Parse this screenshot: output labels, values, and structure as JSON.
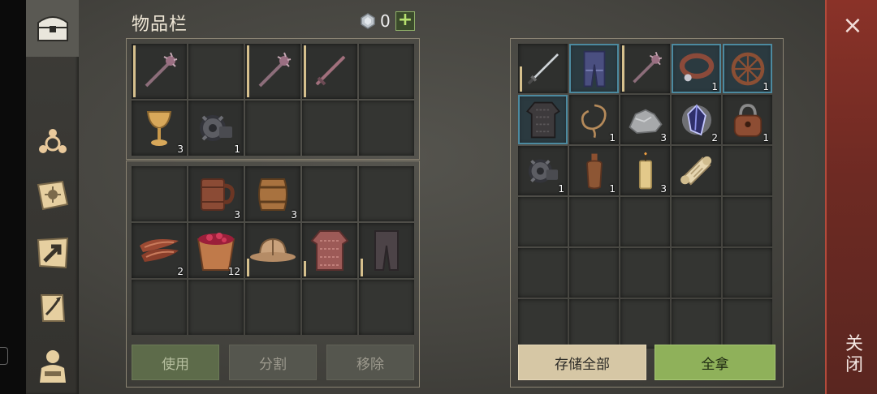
{
  "title": "物品栏",
  "gem_count": "0",
  "plus_label": "+",
  "buttons": {
    "use": "使用",
    "split": "分割",
    "remove": "移除",
    "store_all": "存储全部",
    "take_all": "全拿"
  },
  "close": {
    "icon": "×",
    "label": "关闭"
  },
  "sidebar": [
    {
      "name": "chest-icon"
    },
    {
      "name": "skills-icon"
    },
    {
      "name": "recipes-book-icon"
    },
    {
      "name": "map-arrow-icon"
    },
    {
      "name": "quests-scroll-icon"
    },
    {
      "name": "character-icon"
    }
  ],
  "inventory_top": [
    {
      "item": "mace-icon",
      "qty": "",
      "bar": 1.0
    },
    {
      "item": "empty",
      "qty": ""
    },
    {
      "item": "mace-icon",
      "qty": "",
      "bar": 1.0
    },
    {
      "item": "sword-icon",
      "qty": "",
      "bar": 1.0
    },
    {
      "item": "empty",
      "qty": ""
    },
    {
      "item": "goblet-icon",
      "qty": "3"
    },
    {
      "item": "gear-scrap-icon",
      "qty": "1"
    },
    {
      "item": "empty",
      "qty": ""
    },
    {
      "item": "empty",
      "qty": ""
    },
    {
      "item": "empty",
      "qty": ""
    }
  ],
  "inventory_bottom": [
    {
      "item": "empty",
      "qty": ""
    },
    {
      "item": "mug-icon",
      "qty": "3"
    },
    {
      "item": "barrel-icon",
      "qty": "3"
    },
    {
      "item": "empty",
      "qty": ""
    },
    {
      "item": "empty",
      "qty": ""
    },
    {
      "item": "meat-icon",
      "qty": "2"
    },
    {
      "item": "berry-bucket-icon",
      "qty": "12"
    },
    {
      "item": "helmet-icon",
      "qty": "",
      "bar": 0.35
    },
    {
      "item": "chainmail-icon",
      "qty": "",
      "bar": 0.3
    },
    {
      "item": "pants-icon",
      "qty": "",
      "bar": 0.35
    },
    {
      "item": "empty",
      "qty": ""
    },
    {
      "item": "empty",
      "qty": ""
    },
    {
      "item": "empty",
      "qty": ""
    },
    {
      "item": "empty",
      "qty": ""
    },
    {
      "item": "empty",
      "qty": ""
    }
  ],
  "chest": [
    {
      "item": "longsword-icon",
      "qty": "",
      "bar": 0.55
    },
    {
      "item": "blue-pants-icon",
      "qty": "",
      "sel": true
    },
    {
      "item": "mace-icon",
      "qty": "",
      "bar": 1.0
    },
    {
      "item": "collar-icon",
      "qty": "1",
      "sel": true
    },
    {
      "item": "wheel-icon",
      "qty": "1",
      "sel": true
    },
    {
      "item": "dark-armor-icon",
      "qty": "",
      "sel": true
    },
    {
      "item": "rope-icon",
      "qty": "1"
    },
    {
      "item": "stone-icon",
      "qty": "3"
    },
    {
      "item": "crystal-icon",
      "qty": "2"
    },
    {
      "item": "padlock-icon",
      "qty": "1"
    },
    {
      "item": "gear-scrap-icon",
      "qty": "1"
    },
    {
      "item": "bottle-icon",
      "qty": "1"
    },
    {
      "item": "candle-icon",
      "qty": "3"
    },
    {
      "item": "scroll-icon",
      "qty": ""
    },
    {
      "item": "empty",
      "qty": ""
    },
    {
      "item": "empty",
      "qty": ""
    },
    {
      "item": "empty",
      "qty": ""
    },
    {
      "item": "empty",
      "qty": ""
    },
    {
      "item": "empty",
      "qty": ""
    },
    {
      "item": "empty",
      "qty": ""
    },
    {
      "item": "empty",
      "qty": ""
    },
    {
      "item": "empty",
      "qty": ""
    },
    {
      "item": "empty",
      "qty": ""
    },
    {
      "item": "empty",
      "qty": ""
    },
    {
      "item": "empty",
      "qty": ""
    },
    {
      "item": "empty",
      "qty": ""
    },
    {
      "item": "empty",
      "qty": ""
    },
    {
      "item": "empty",
      "qty": ""
    },
    {
      "item": "empty",
      "qty": ""
    },
    {
      "item": "empty",
      "qty": ""
    }
  ]
}
